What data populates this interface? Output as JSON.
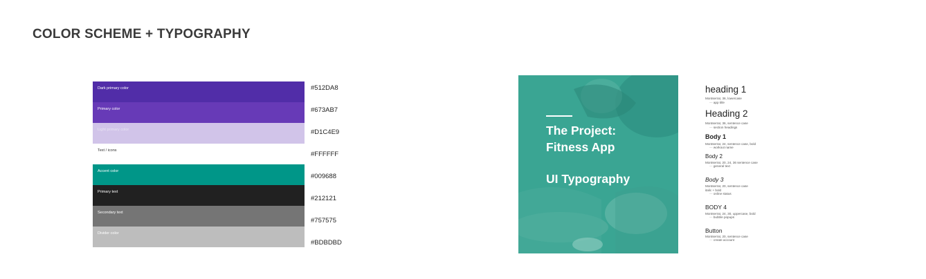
{
  "title": "COLOR SCHEME + TYPOGRAPHY",
  "palette": [
    {
      "label": "Dark primary color",
      "hex": "#512DA8",
      "color": "#512DA8"
    },
    {
      "label": "Primary color",
      "hex": "#673AB7",
      "color": "#673AB7"
    },
    {
      "label": "Light primary color",
      "hex": "#D1C4E9",
      "color": "#D1C4E9"
    },
    {
      "label": "Text / icons",
      "hex": "#FFFFFF",
      "color": "#FFFFFF"
    },
    {
      "label": "Accent color",
      "hex": "#009688",
      "color": "#009688"
    },
    {
      "label": "Primary text",
      "hex": "#212121",
      "color": "#212121"
    },
    {
      "label": "Secondary text",
      "hex": "#757575",
      "color": "#757575"
    },
    {
      "label": "Divider color",
      "hex": "#BDBDBD",
      "color": "#BDBDBD"
    }
  ],
  "hero": {
    "line1": "The Project:",
    "line2": "Fitness App",
    "line3": "UI Typography",
    "overlay_color": "#2f9f8e"
  },
  "typography": [
    {
      "name": "heading 1",
      "meta": "Montserrat, 36, lowercase",
      "use": "app title"
    },
    {
      "name": "Heading 2",
      "meta": "Montserrat, 36, sentence case",
      "use": "section headings"
    },
    {
      "name": "Body 1",
      "meta": "Montserrat, 24, sentence case, bold",
      "use": "workout name"
    },
    {
      "name": "Body 2",
      "meta": "Montserrat, 20, 24, 36 sentence case",
      "use": "general text"
    },
    {
      "name": "Body 3",
      "meta": "Montserrat, 20, sentence case",
      "meta2": "italic + bold",
      "use": "online status"
    },
    {
      "name": "BODY 4",
      "meta": "Montserrat, 24, 30, uppercase, bold",
      "use": "bubble popups"
    },
    {
      "name": "Button",
      "meta": "Montserrat, 20, sentence case",
      "use": "create account"
    }
  ]
}
